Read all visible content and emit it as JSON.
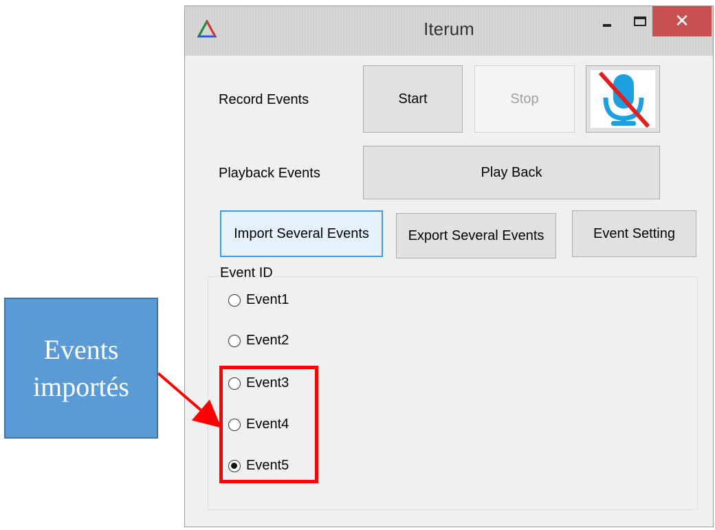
{
  "window": {
    "title": "Iterum",
    "close_glyph": "✕"
  },
  "record": {
    "label": "Record Events",
    "start_label": "Start",
    "stop_label": "Stop",
    "mic_icon": "microphone-muted-icon"
  },
  "playback": {
    "label": "Playback Events",
    "play_label": "Play Back"
  },
  "actions": {
    "import_label": "Import Several Events",
    "export_label": "Export Several Events",
    "setting_label": "Event Setting"
  },
  "event_group": {
    "title": "Event ID",
    "items": [
      {
        "label": "Event1",
        "checked": false
      },
      {
        "label": "Event2",
        "checked": false
      },
      {
        "label": "Event3",
        "checked": false
      },
      {
        "label": "Event4",
        "checked": false
      },
      {
        "label": "Event5",
        "checked": true
      }
    ]
  },
  "annotation": {
    "callout_text": "Events\nimportés",
    "callout_color": "#5b9bd5",
    "highlight_color": "#ff0000"
  }
}
